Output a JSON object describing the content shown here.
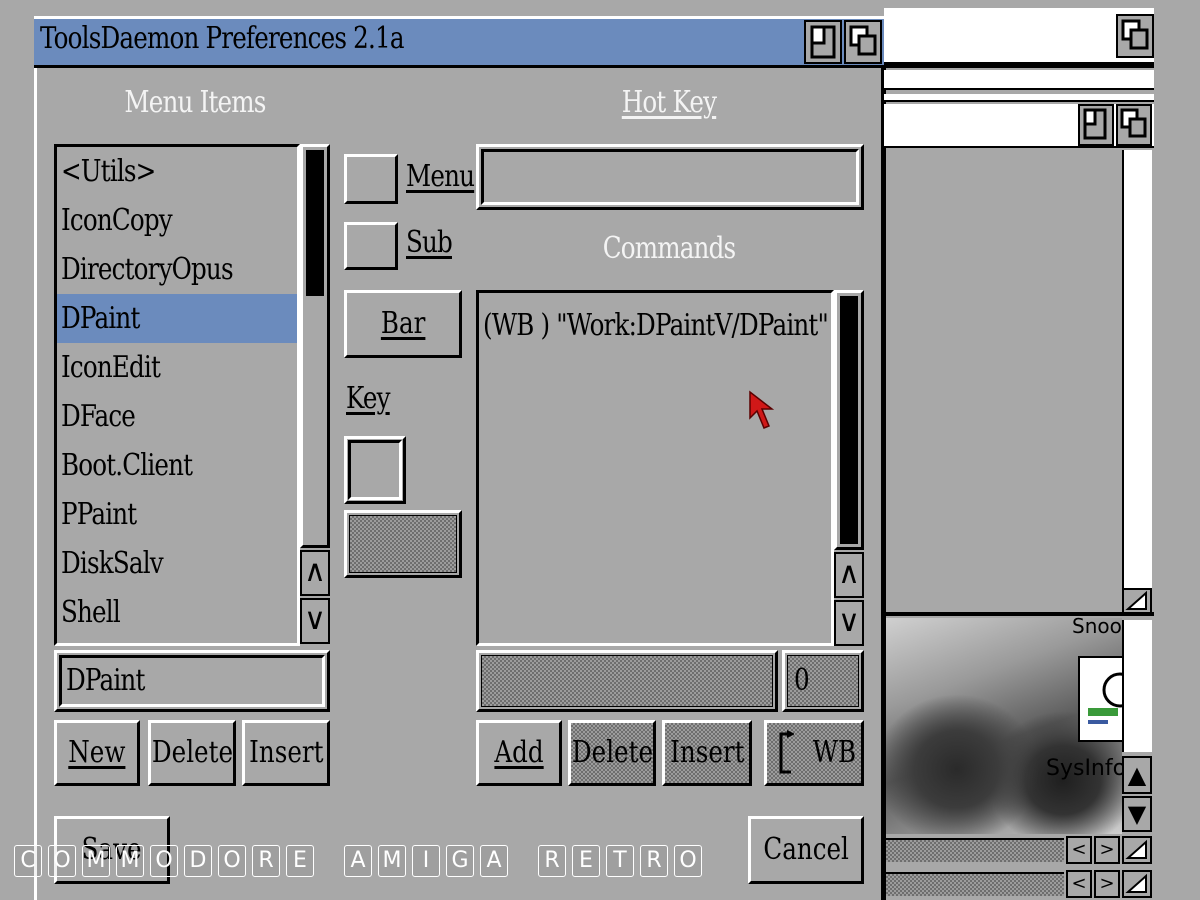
{
  "window": {
    "title": "ToolsDaemon Preferences 2.1a",
    "title_bar_color": "#6b8bbd"
  },
  "menu_items": {
    "heading": "Menu Items",
    "items": [
      "<Utils>",
      "IconCopy",
      "DirectoryOpus",
      "DPaint",
      "IconEdit",
      "DFace",
      "Boot.Client",
      "PPaint",
      "DiskSalv",
      "Shell"
    ],
    "selected": "DPaint",
    "name_field": "DPaint",
    "buttons": {
      "new": "New",
      "delete": "Delete",
      "insert": "Insert"
    }
  },
  "middle": {
    "menu_label": "Menu",
    "sub_label": "Sub",
    "bar_label": "Bar",
    "key_label": "Key"
  },
  "hot_key": {
    "heading": "Hot Key",
    "value": ""
  },
  "commands": {
    "heading": "Commands",
    "lines": [
      "(WB ) \"Work:DPaintV/DPaint\" []"
    ],
    "field_value": "",
    "number_value": "0",
    "buttons": {
      "add": "Add",
      "delete": "Delete",
      "insert": "Insert",
      "wb": "WB"
    }
  },
  "footer": {
    "save": "Save",
    "cancel": "Cancel"
  },
  "background_window": {
    "icon_labels": [
      "Snoop",
      "SysInfo-"
    ]
  },
  "watermark": {
    "text": "COMMODORE AMIGA RETRO",
    "words": [
      "COMMODORE",
      "AMIGA",
      "RETRO"
    ]
  },
  "icons": [
    "depth-gadget-icon",
    "zoom-gadget-icon",
    "up-arrow-icon",
    "down-arrow-icon",
    "left-arrow-icon",
    "right-arrow-icon",
    "resize-icon",
    "mouse-pointer-icon"
  ],
  "colors": {
    "background": "#a8a8a8",
    "selection": "#6b8bbd",
    "pointer": "#d01818"
  }
}
